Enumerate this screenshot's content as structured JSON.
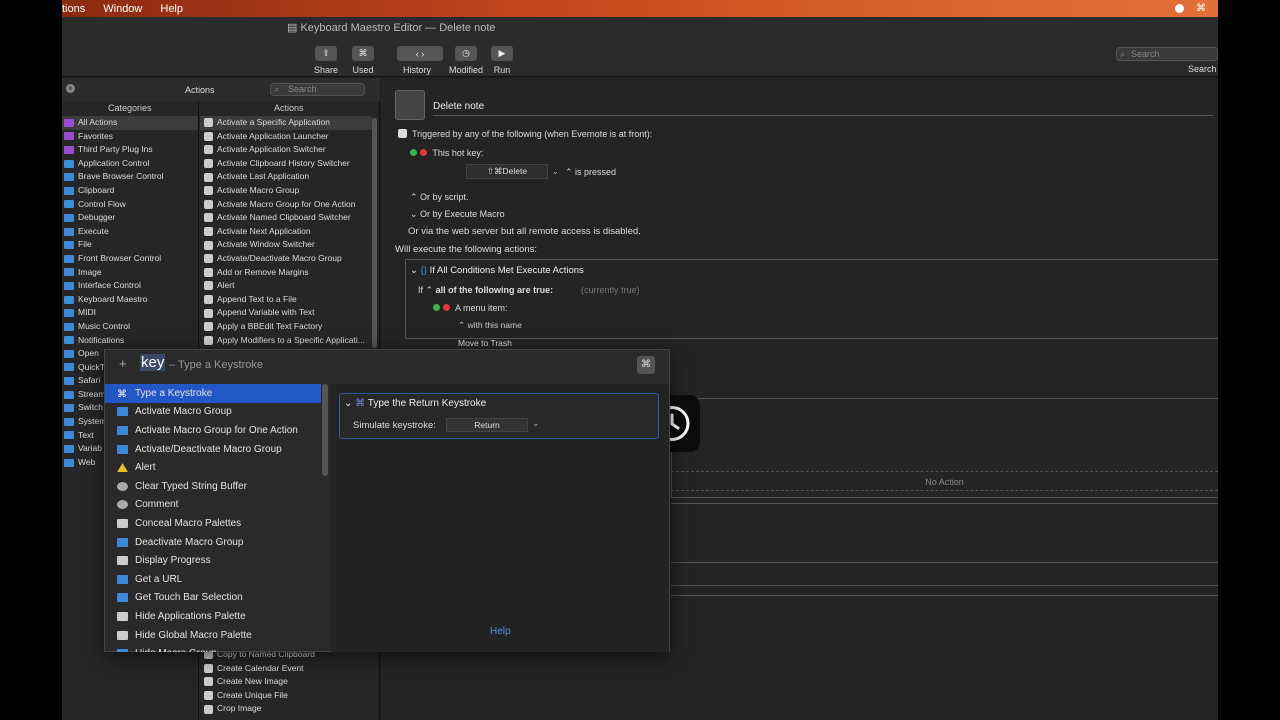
{
  "menubar": {
    "items": [
      "tions",
      "Window",
      "Help"
    ]
  },
  "window": {
    "title": "Keyboard Maestro Editor — Delete note"
  },
  "toolbar": {
    "share": "Share",
    "used": "Used",
    "history": "History",
    "modified": "Modified",
    "run": "Run",
    "search_placeholder": "Search",
    "search_label": "Search"
  },
  "left": {
    "header": "Actions",
    "search_placeholder": "Search",
    "categories_header": "Categories",
    "actions_header": "Actions",
    "categories": [
      "All Actions",
      "Favorites",
      "Third Party Plug Ins",
      "Application Control",
      "Brave Browser Control",
      "Clipboard",
      "Control Flow",
      "Debugger",
      "Execute",
      "File",
      "Front Browser Control",
      "Image",
      "Interface Control",
      "Keyboard Maestro",
      "MIDI",
      "Music Control",
      "Notifications",
      "Open",
      "QuickT",
      "Safari",
      "Stream",
      "Switch",
      "System",
      "Text",
      "Variab",
      "Web"
    ],
    "actions": [
      "Activate a Specific Application",
      "Activate Application Launcher",
      "Activate Application Switcher",
      "Activate Clipboard History Switcher",
      "Activate Last Application",
      "Activate Macro Group",
      "Activate Macro Group for One Action",
      "Activate Named Clipboard Switcher",
      "Activate Next Application",
      "Activate Window Switcher",
      "Activate/Deactivate Macro Group",
      "Add or Remove Margins",
      "Alert",
      "Append Text to a File",
      "Append Variable with Text",
      "Apply a BBEdit Text Factory",
      "Apply Modifiers to a Specific Applicati..."
    ],
    "actions_bottom": [
      "Copy to Named Clipboard",
      "Create Calendar Event",
      "Create New Image",
      "Create Unique File",
      "Crop Image"
    ]
  },
  "macro": {
    "name": "Delete note",
    "trigger_text": "Triggered by any of the following (when Evernote is at front):",
    "hotkey_label": "This hot key:",
    "hotkey_value": "⇧⌘Delete",
    "is_pressed": "is pressed",
    "or_script": "Or by script.",
    "or_execute": "Or by Execute Macro",
    "web_server": "Or via the web server but all remote access is disabled.",
    "will_execute": "Will execute the following actions:",
    "if_block": "If All Conditions Met Execute Actions",
    "if_label": "If",
    "all_following": "all of the following are true:",
    "currently": "(currently true)",
    "menu_item": "A menu item:",
    "with_name": "with this name",
    "move_trash": "Move to Trash",
    "no_action": "No Action"
  },
  "popup": {
    "query": "key",
    "hint": "– Type a Keystroke",
    "results": [
      "Type a Keystroke",
      "Activate Macro Group",
      "Activate Macro Group for One Action",
      "Activate/Deactivate Macro Group",
      "Alert",
      "Clear Typed String Buffer",
      "Comment",
      "Conceal Macro Palettes",
      "Deactivate Macro Group",
      "Display Progress",
      "Get a URL",
      "Get Touch Bar Selection",
      "Hide Applications Palette",
      "Hide Global Macro Palette",
      "Hide Macro Group"
    ],
    "preview_title": "Type the Return Keystroke",
    "simulate_label": "Simulate keystroke:",
    "simulate_value": "Return",
    "help": "Help"
  },
  "colors": {
    "accent": "#2457c6",
    "menubar": "#c2451c",
    "link": "#4a8fe0"
  }
}
